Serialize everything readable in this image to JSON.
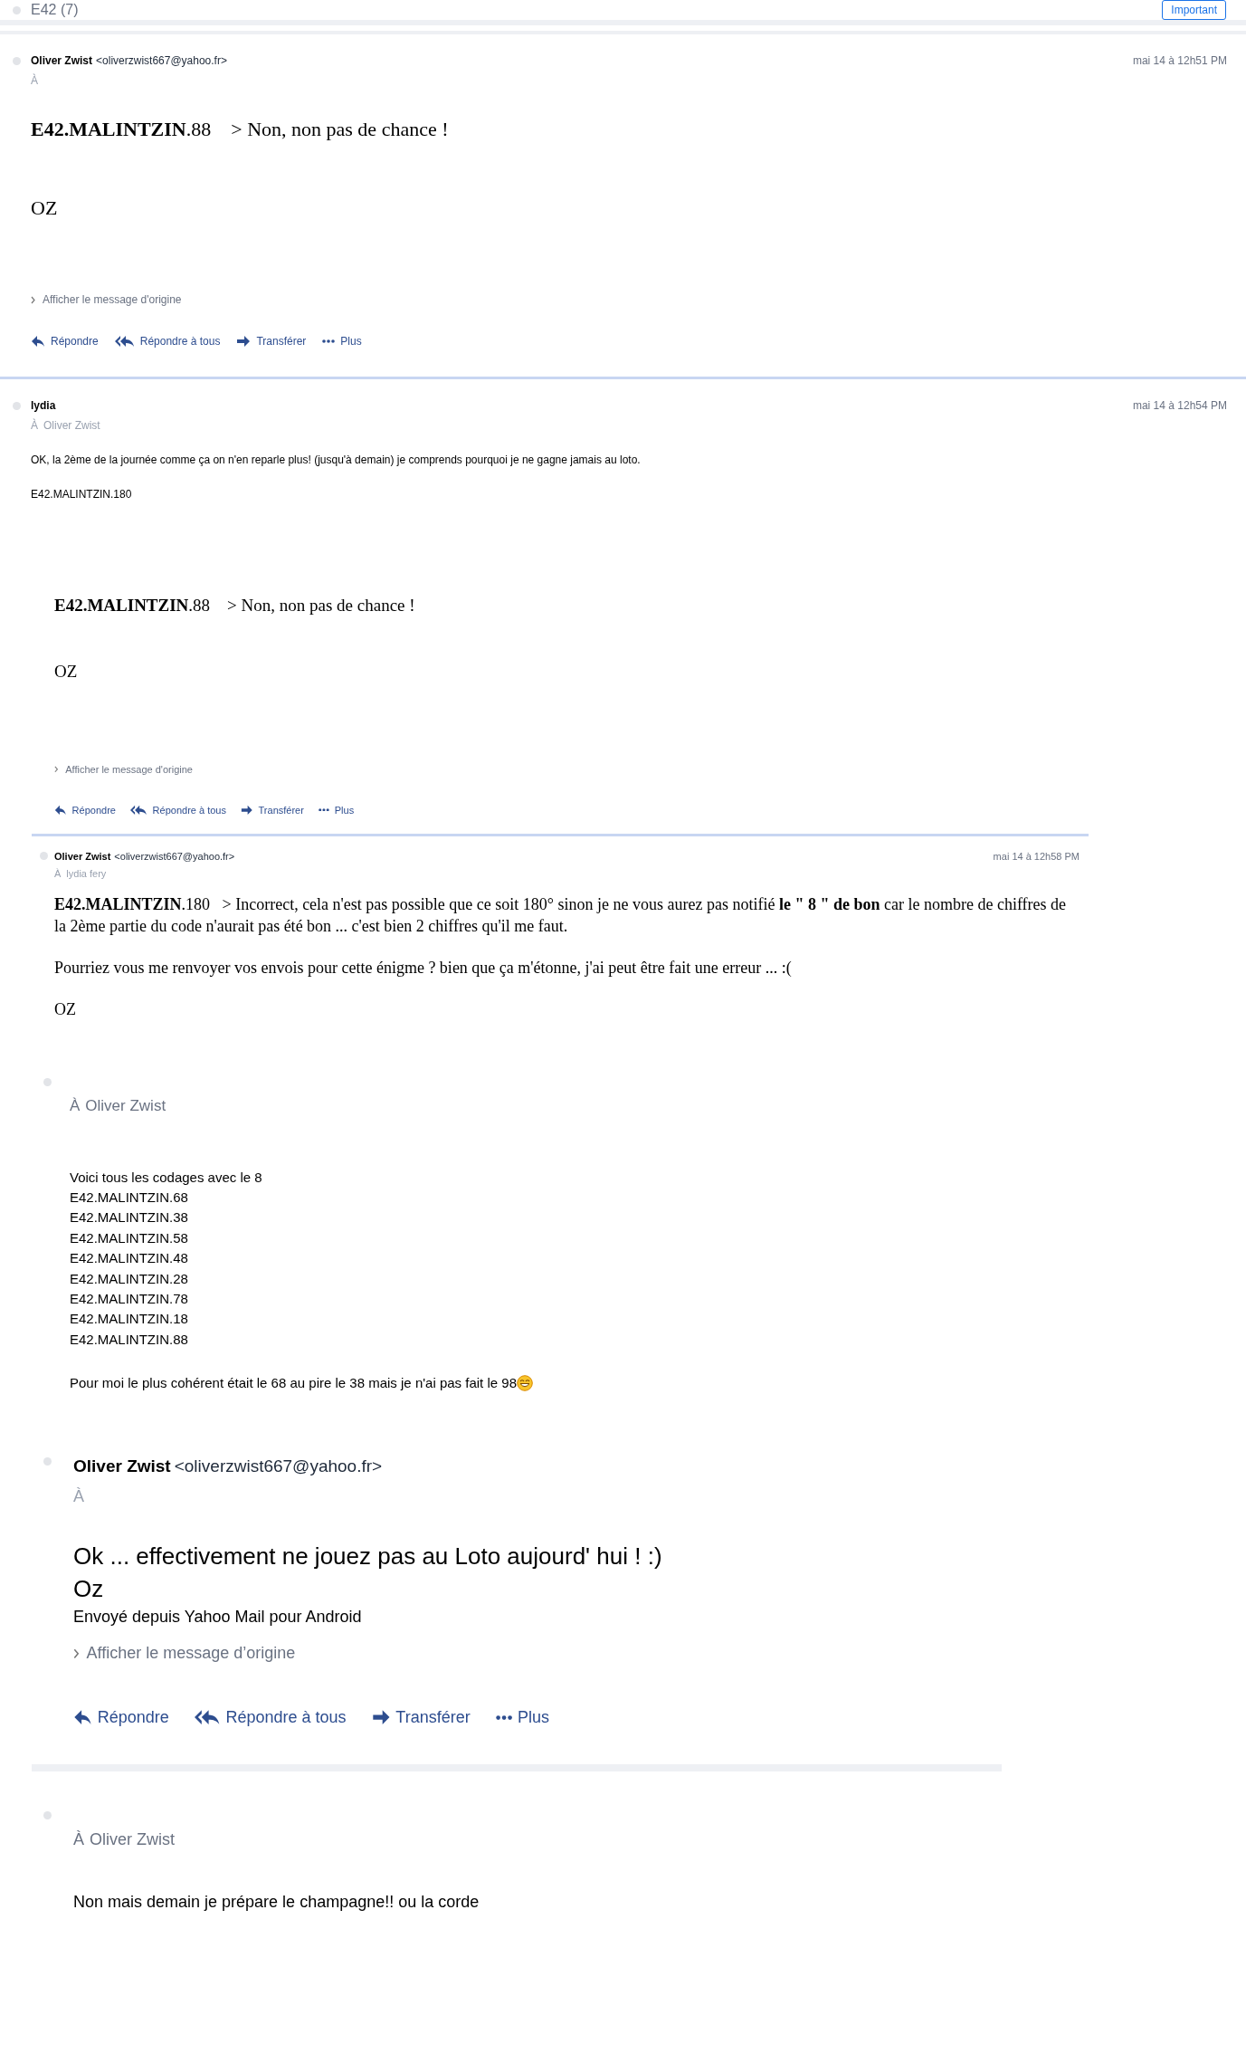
{
  "thread": {
    "title": "E42 (7)",
    "important_button": "Important"
  },
  "messages": [
    {
      "sender": "Oliver Zwist",
      "email": "<oliverzwist667@yahoo.fr>",
      "to_label": "À",
      "date": "mai 14 à 12h51 PM",
      "body": [
        {
          "kind": "para",
          "text": "**E42.MALINTZIN**.88    > Non, non pas de chance !"
        },
        {
          "kind": "para",
          "text": "OZ"
        }
      ],
      "show_original": "Afficher le message d'origine",
      "actions": [
        {
          "kind": "reply",
          "label": "Répondre"
        },
        {
          "kind": "reply_all",
          "label": "Répondre à tous"
        },
        {
          "kind": "forward",
          "label": "Transférer"
        },
        {
          "kind": "more",
          "label": "Plus"
        }
      ]
    },
    {
      "sender": "lydia",
      "to_label": "À",
      "to": "Oliver Zwist",
      "date": "mai 14 à 12h54 PM",
      "body": [
        {
          "kind": "para",
          "text": "OK, la 2ème de la journée comme ça on n'en reparle plus! (jusqu'à demain) je comprends pourquoi je ne gagne jamais au loto."
        },
        {
          "kind": "para",
          "text": "E42.MALINTZIN.180"
        }
      ]
    },
    {
      "body": [
        {
          "kind": "para",
          "text": "**E42.MALINTZIN**.88    > Non, non pas de chance !"
        },
        {
          "kind": "para",
          "text": "OZ"
        }
      ],
      "show_original": "Afficher le message d'origine",
      "actions": [
        {
          "kind": "reply",
          "label": "Répondre"
        },
        {
          "kind": "reply_all",
          "label": "Répondre à tous"
        },
        {
          "kind": "forward",
          "label": "Transférer"
        },
        {
          "kind": "more",
          "label": "Plus"
        }
      ]
    },
    {
      "sender": "Oliver Zwist",
      "email": "<oliverzwist667@yahoo.fr>",
      "to_label": "À",
      "to": "lydia fery",
      "date": "mai 14 à 12h58 PM",
      "body": [
        {
          "kind": "para",
          "text": "**E42.MALINTZIN**.180   > Incorrect, cela n'est pas possible que ce soit 180° sinon je ne vous aurez pas notifié **le \" 8 \" de bon** car le nombre de chiffres de la 2ème partie du code n'aurait pas été bon ... c'est bien 2 chiffres qu'il me faut."
        },
        {
          "kind": "para",
          "text": "Pourriez vous me renvoyer vos envois pour cette énigme ? bien que ça m'étonne, j'ai peut être fait une erreur ... :("
        },
        {
          "kind": "para",
          "text": "OZ"
        }
      ]
    },
    {
      "to_label": "À",
      "to": "Oliver Zwist",
      "body": [
        {
          "kind": "line",
          "text": "Voici tous les codages avec le 8"
        },
        {
          "kind": "line",
          "text": "E42.MALINTZIN.68"
        },
        {
          "kind": "line",
          "text": "E42.MALINTZIN.38"
        },
        {
          "kind": "line",
          "text": "E42.MALINTZIN.58"
        },
        {
          "kind": "line",
          "text": "E42.MALINTZIN.48"
        },
        {
          "kind": "line",
          "text": "E42.MALINTZIN.28"
        },
        {
          "kind": "line",
          "text": "E42.MALINTZIN.78"
        },
        {
          "kind": "line",
          "text": "E42.MALINTZIN.18"
        },
        {
          "kind": "para",
          "text": "E42.MALINTZIN.88"
        },
        {
          "kind": "emoji_para",
          "text": "Pour moi le plus cohérent était le 68 au pire le 38 mais je n'ai pas fait le 98"
        }
      ]
    },
    {
      "sender": "Oliver Zwist",
      "email": "<oliverzwist667@yahoo.fr>",
      "to_label": "À",
      "body": [
        {
          "kind": "big_line",
          "text": "Ok ... effectivement ne jouez pas au Loto aujourd' hui ! :)"
        },
        {
          "kind": "big_line",
          "text": "Oz"
        },
        {
          "kind": "line",
          "text": "Envoyé depuis Yahoo Mail pour Android"
        }
      ],
      "show_original": "Afficher le message d’origine",
      "actions": [
        {
          "kind": "reply",
          "label": "Répondre"
        },
        {
          "kind": "reply_all",
          "label": "Répondre à tous"
        },
        {
          "kind": "forward",
          "label": "Transférer"
        },
        {
          "kind": "more",
          "label": "Plus"
        }
      ]
    },
    {
      "to_label": "À",
      "to": "Oliver Zwist",
      "body": [
        {
          "kind": "para",
          "text": "Non mais demain je prépare le champagne!! ou la corde"
        }
      ]
    }
  ]
}
